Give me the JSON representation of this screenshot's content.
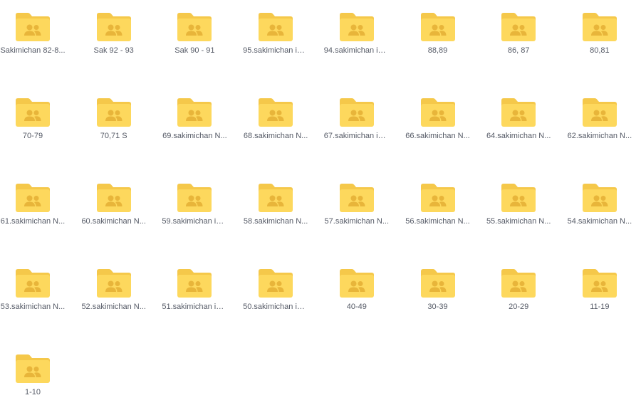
{
  "folders": [
    {
      "label": "Sakimichan 82-8..."
    },
    {
      "label": "Sak 92 - 93"
    },
    {
      "label": "Sak 90 - 91"
    },
    {
      "label": "95.sakimichan iss..."
    },
    {
      "label": "94.sakimichan iss..."
    },
    {
      "label": "88,89"
    },
    {
      "label": "86, 87"
    },
    {
      "label": "80,81"
    },
    {
      "label": "70-79"
    },
    {
      "label": "70,71 S"
    },
    {
      "label": "69.sakimichan N..."
    },
    {
      "label": "68.sakimichan N..."
    },
    {
      "label": "67.sakimichan iss..."
    },
    {
      "label": "66.sakimichan N..."
    },
    {
      "label": "64.sakimichan N..."
    },
    {
      "label": "62.sakimichan N..."
    },
    {
      "label": "61.sakimichan N..."
    },
    {
      "label": "60.sakimichan N..."
    },
    {
      "label": "59.sakimichan iss..."
    },
    {
      "label": "58.sakimichan N..."
    },
    {
      "label": "57.sakimichan N..."
    },
    {
      "label": "56.sakimichan N..."
    },
    {
      "label": "55.sakimichan N..."
    },
    {
      "label": "54.sakimichan N..."
    },
    {
      "label": "53.sakimichan N..."
    },
    {
      "label": "52.sakimichan N..."
    },
    {
      "label": "51.sakimichan iss..."
    },
    {
      "label": "50.sakimichan iss..."
    },
    {
      "label": "40-49"
    },
    {
      "label": "30-39"
    },
    {
      "label": "20-29"
    },
    {
      "label": "11-19"
    },
    {
      "label": "1-10"
    }
  ],
  "icon": "shared-folder-icon",
  "colors": {
    "folder_back": "#f5c84a",
    "folder_front": "#fdd85d",
    "folder_people": "#e8b53a",
    "label": "#555a66"
  }
}
